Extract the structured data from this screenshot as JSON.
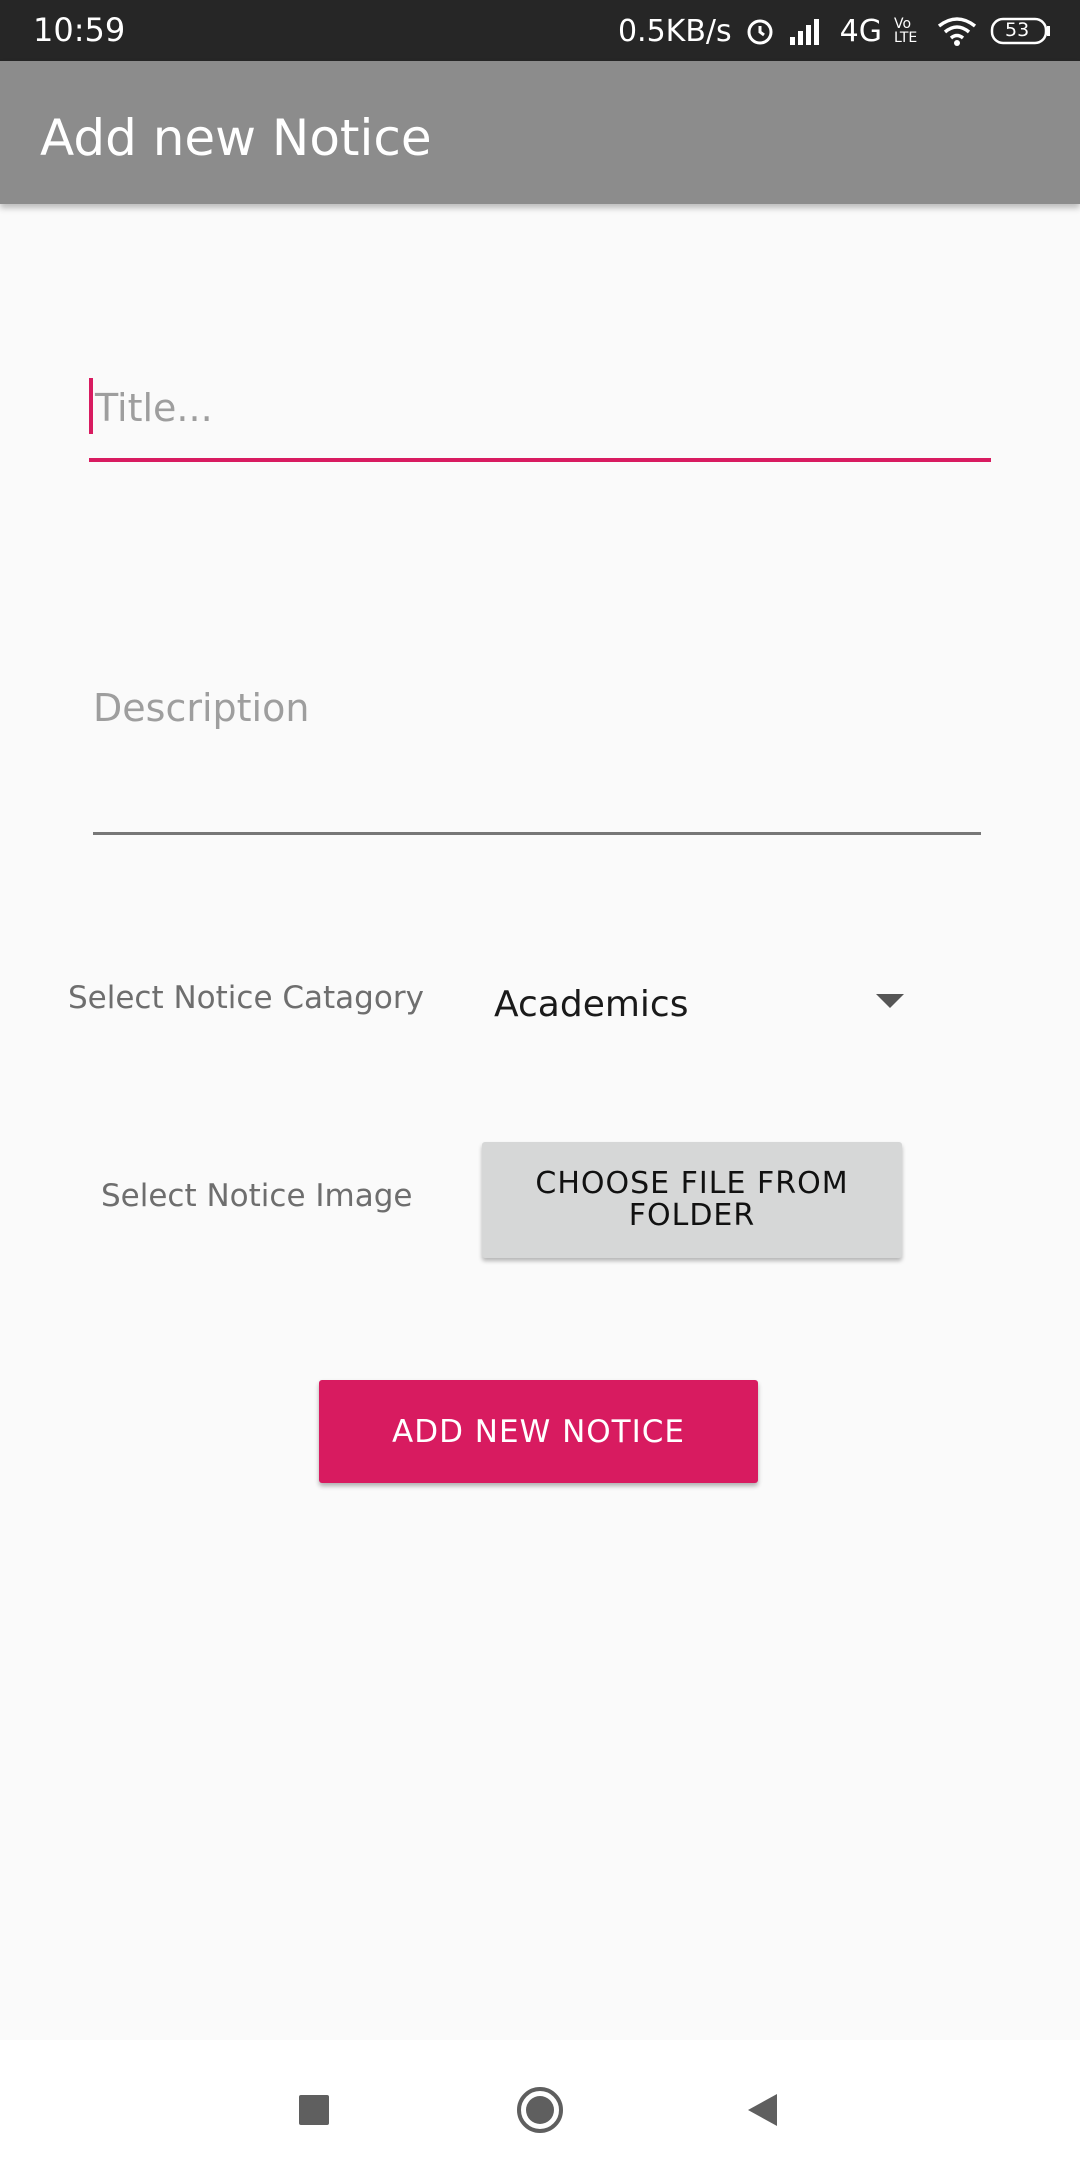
{
  "status_bar": {
    "time": "10:59",
    "net_speed": "0.5KB/s",
    "network": "4G",
    "volte": "Vo LTE",
    "battery": "53",
    "icons": [
      "alarm-icon",
      "signal-icon",
      "wifi-icon",
      "battery-icon"
    ]
  },
  "app_bar": {
    "title": "Add new Notice"
  },
  "form": {
    "title_placeholder": "Title...",
    "title_value": "",
    "description_placeholder": "Description",
    "description_value": "",
    "category_label": "Select Notice Catagory",
    "category_selected": "Academics",
    "image_label": "Select Notice Image",
    "choose_file_label": "CHOOSE FILE FROM FOLDER",
    "submit_label": "ADD NEW NOTICE"
  },
  "nav_bar": {
    "icons": [
      "recents-icon",
      "home-icon",
      "back-icon"
    ]
  },
  "colors": {
    "accent": "#d81b60",
    "app_bar": "#8c8c8c",
    "status_bar": "#262626",
    "background": "#fafafa"
  }
}
